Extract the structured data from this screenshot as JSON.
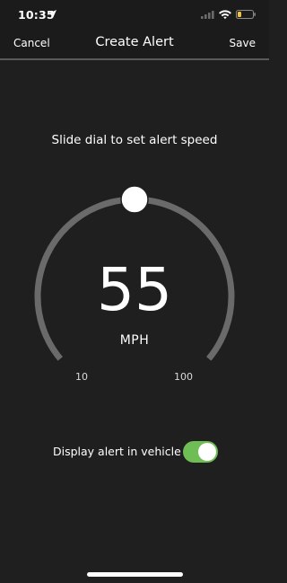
{
  "status_bar": {
    "time": "10:35",
    "location_icon": "location-arrow-icon",
    "signal_icon": "cellular-signal-icon",
    "wifi_icon": "wifi-icon",
    "battery_icon": "battery-low-icon",
    "battery_color": "#f2c230"
  },
  "nav": {
    "cancel_label": "Cancel",
    "title": "Create Alert",
    "save_label": "Save"
  },
  "dial": {
    "instruction": "Slide dial to set alert speed",
    "value": "55",
    "unit": "MPH",
    "min_label": "10",
    "max_label": "100",
    "current_speed": 55,
    "min_speed": 10,
    "max_speed": 100,
    "track_color": "#6a6a6a",
    "knob_color": "#ffffff"
  },
  "vehicle_alert": {
    "label": "Display alert in vehicle",
    "enabled": true,
    "on_color": "#6fbe55"
  }
}
